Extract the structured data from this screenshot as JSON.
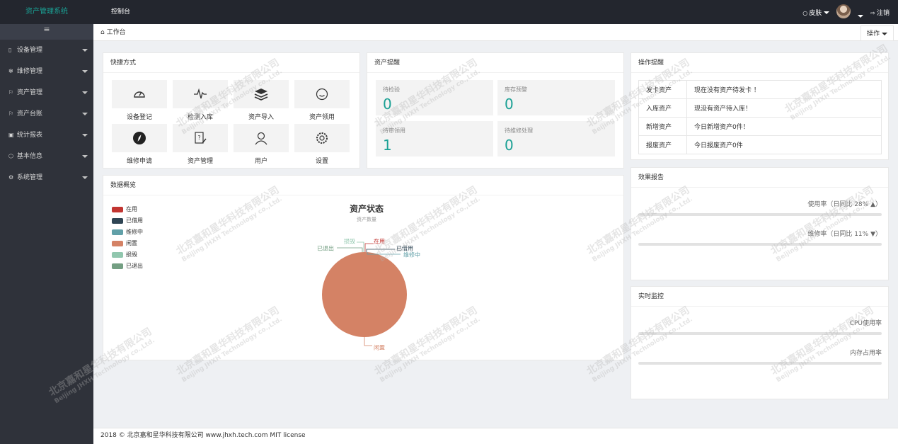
{
  "app": {
    "title": "资产管理系统",
    "nav_console": "控制台"
  },
  "topbar": {
    "skin_label": "皮肤",
    "logout_label": "注销"
  },
  "sidebar": {
    "toggle": "≡",
    "items": [
      {
        "label": "设备管理",
        "icon": "device-icon"
      },
      {
        "label": "维修管理",
        "icon": "gear-icon"
      },
      {
        "label": "资产管理",
        "icon": "flag-icon"
      },
      {
        "label": "资产台账",
        "icon": "flag-icon"
      },
      {
        "label": "统计报表",
        "icon": "report-icon"
      },
      {
        "label": "基本信息",
        "icon": "info-icon"
      },
      {
        "label": "系统管理",
        "icon": "settings-icon"
      }
    ]
  },
  "tabs": {
    "current": "工作台",
    "ops_label": "操作"
  },
  "quick": {
    "title": "快捷方式",
    "items": [
      {
        "label": "设备登记",
        "icon": "gauge-icon"
      },
      {
        "label": "检测入库",
        "icon": "pulse-icon"
      },
      {
        "label": "资产导入",
        "icon": "layers-icon"
      },
      {
        "label": "资产领用",
        "icon": "smile-icon"
      },
      {
        "label": "维修申请",
        "icon": "compass-icon"
      },
      {
        "label": "资产管理",
        "icon": "edit-doc-icon"
      },
      {
        "label": "用户",
        "icon": "user-icon"
      },
      {
        "label": "设置",
        "icon": "settings-icon"
      }
    ]
  },
  "reminders": {
    "title": "资产提醒",
    "items": [
      {
        "label": "待检验",
        "value": "0"
      },
      {
        "label": "库存预警",
        "value": "0"
      },
      {
        "label": "待审领用",
        "value": "1"
      },
      {
        "label": "待维修处理",
        "value": "0"
      }
    ]
  },
  "operations": {
    "title": "操作提醒",
    "rows": [
      {
        "key": "发卡资产",
        "value": "现在没有资产待发卡 ！"
      },
      {
        "key": "入库资产",
        "value": "现没有资产待入库！"
      },
      {
        "key": "新增资产",
        "value": "今日新增资产0件！"
      },
      {
        "key": "报废资产",
        "value": "今日报废资产0件"
      }
    ]
  },
  "effect": {
    "title": "效果报告",
    "usage_label": "使用率（日同比 28% ▲）",
    "usage_value": 0,
    "repair_label": "维修率（日同比 11% ▼）",
    "repair_value": 0
  },
  "monitor": {
    "title": "实时监控",
    "cpu_label": "CPU使用率",
    "cpu_value": 0,
    "mem_label": "内存占用率",
    "mem_value": 0
  },
  "overview": {
    "title": "数据概览"
  },
  "chart_data": {
    "type": "pie",
    "title": "资产状态",
    "subtitle": "资产数量",
    "legend_position": "top-left",
    "categories": [
      "在用",
      "已借用",
      "维修中",
      "闲置",
      "损毁",
      "已退出"
    ],
    "values": [
      0,
      0,
      0,
      1,
      0,
      0
    ],
    "colors": [
      "#c23531",
      "#2f4554",
      "#61a0a8",
      "#d48265",
      "#91c7ae",
      "#749f83"
    ]
  },
  "footer": {
    "text": "2018 © 北京嘉和星华科技有限公司 www.jhxh.tech.com MIT license"
  },
  "watermark": {
    "text_cn": "北京嘉和星华科技有限公司",
    "text_en": "Beijing JHXH Technology co.,Ltd."
  }
}
